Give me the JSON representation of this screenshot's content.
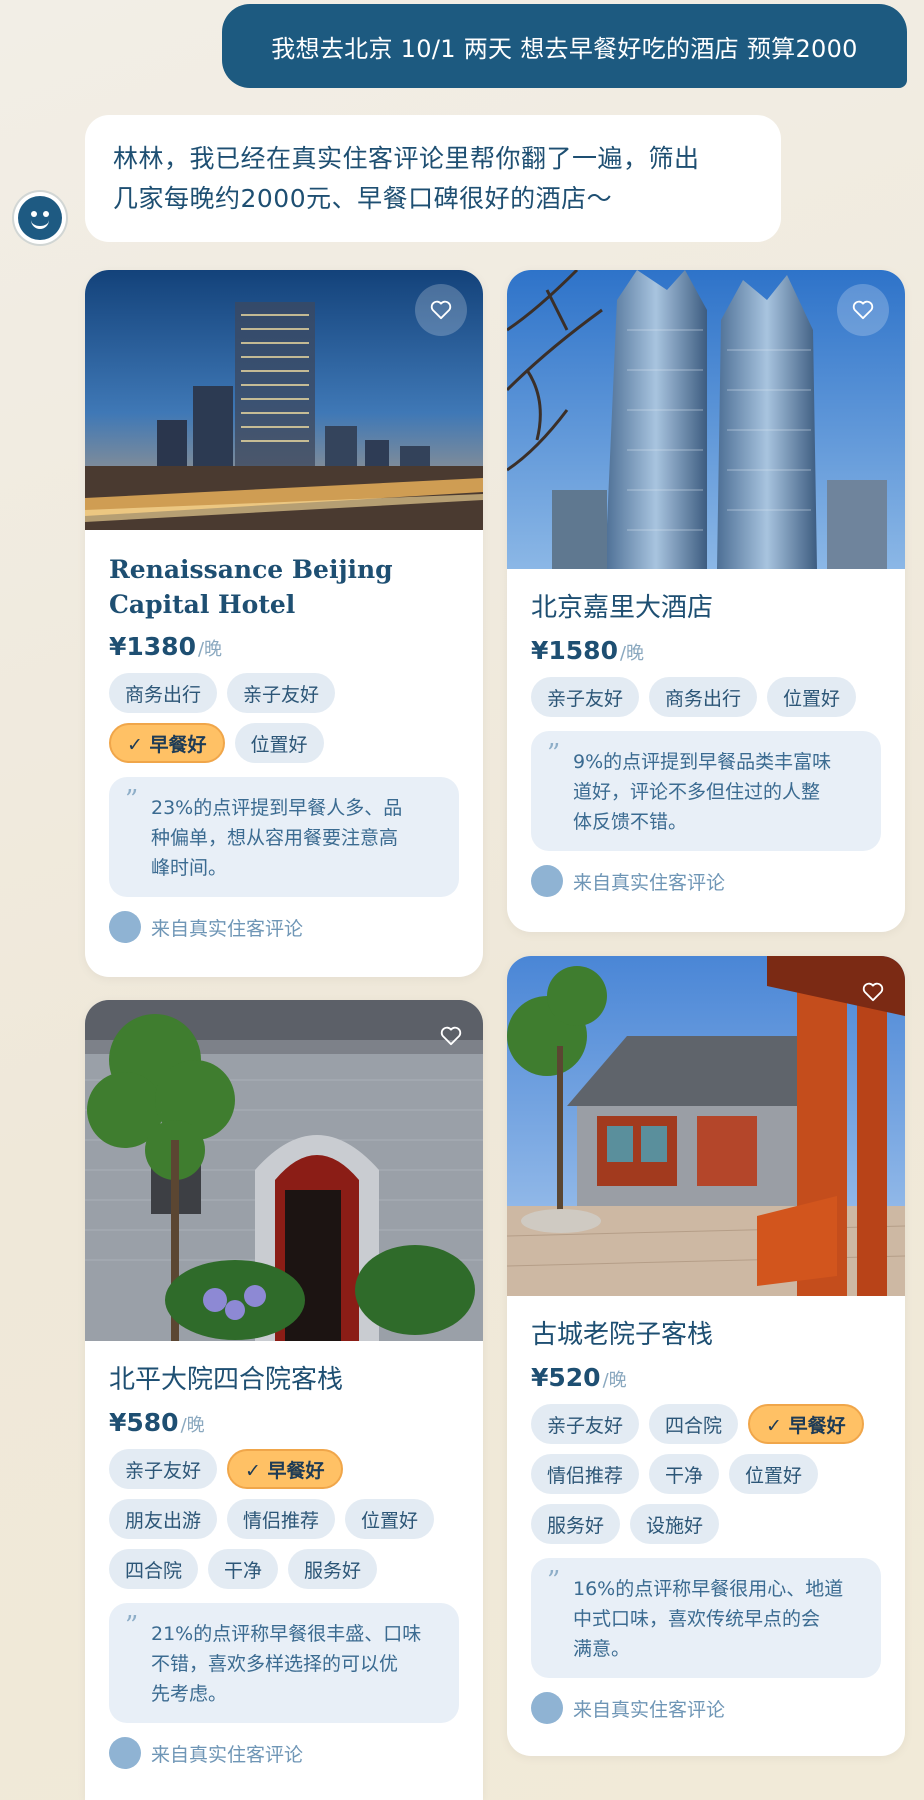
{
  "chat": {
    "user_message": "我想去北京 10/1 两天 想去早餐好吃的酒店 预算2000",
    "assistant_line1": "林林，我已经在真实住客评论里帮你翻了一遍，筛出",
    "assistant_line2": "几家每晚约2000元、早餐口碑很好的酒店～"
  },
  "hotels": [
    {
      "name_line1": "Renaissance Beijing",
      "name_line2": "Capital Hotel",
      "price": "¥1380",
      "unit": "/晚",
      "tags": [
        "商务出行",
        "亲子友好",
        "✓ 早餐好",
        "位置好"
      ],
      "quote_line1": "23%的点评提到早餐人多、品",
      "quote_line2": "种偏单，想从容用餐要注意高",
      "quote_line3": "峰时间。",
      "source": "来自真实住客评论"
    },
    {
      "name_line1": "北京嘉里大酒店",
      "price": "¥1580",
      "unit": "/晚",
      "tags": [
        "亲子友好",
        "商务出行",
        "位置好"
      ],
      "quote_line1": "9%的点评提到早餐品类丰富味",
      "quote_line2": "道好，评论不多但住过的人整",
      "quote_line3": "体反馈不错。",
      "source": "来自真实住客评论"
    },
    {
      "name_line1": "北平大院四合院客栈",
      "price": "¥580",
      "unit": "/晚",
      "tags": [
        "亲子友好",
        "✓ 早餐好",
        "朋友出游",
        "情侣推荐",
        "位置好",
        "四合院",
        "干净",
        "服务好"
      ],
      "quote_line1": "21%的点评称早餐很丰盛、口味",
      "quote_line2": "不错，喜欢多样选择的可以优",
      "quote_line3": "先考虑。",
      "source": "来自真实住客评论"
    },
    {
      "name_line1": "古城老院子客栈",
      "price": "¥520",
      "unit": "/晚",
      "tags": [
        "亲子友好",
        "四合院",
        "✓ 早餐好",
        "情侣推荐",
        "干净",
        "位置好",
        "服务好",
        "设施好"
      ],
      "quote_line1": "16%的点评称早餐很用心、地道",
      "quote_line2": "中式口味，喜欢传统早点的会",
      "quote_line3": "满意。",
      "source": "来自真实住客评论"
    }
  ],
  "icons": {
    "favorite": "heart-icon",
    "quote": "quote-icon",
    "assistant": "smiley-avatar-icon"
  },
  "colors": {
    "user_bubble": "#1d5a80",
    "accent_tag": "#ffc165",
    "tag_bg": "#e3ebf3",
    "text_primary": "#1e4f72"
  }
}
